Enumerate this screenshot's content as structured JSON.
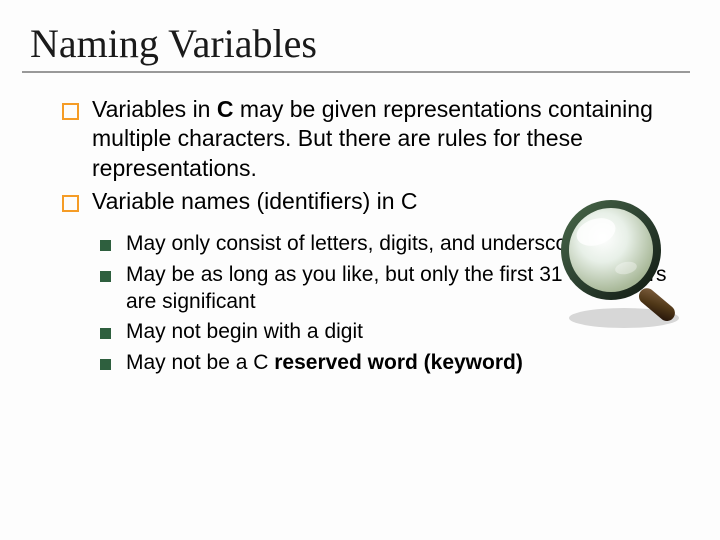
{
  "title": "Naming Variables",
  "bullets": {
    "b1_pre": "Variables in ",
    "b1_bold": "C",
    "b1_post": " may be given representations containing multiple characters.  But there are rules for these representations.",
    "b2": "Variable names (identifiers) in C"
  },
  "sub": {
    "s1": "May only consist of letters, digits, and underscores",
    "s2": "May be as long as you like, but only the first 31 characters are significant",
    "s3": "May not begin with a digit",
    "s4_pre": "May not be a C ",
    "s4_bold": "reserved word (keyword)"
  }
}
